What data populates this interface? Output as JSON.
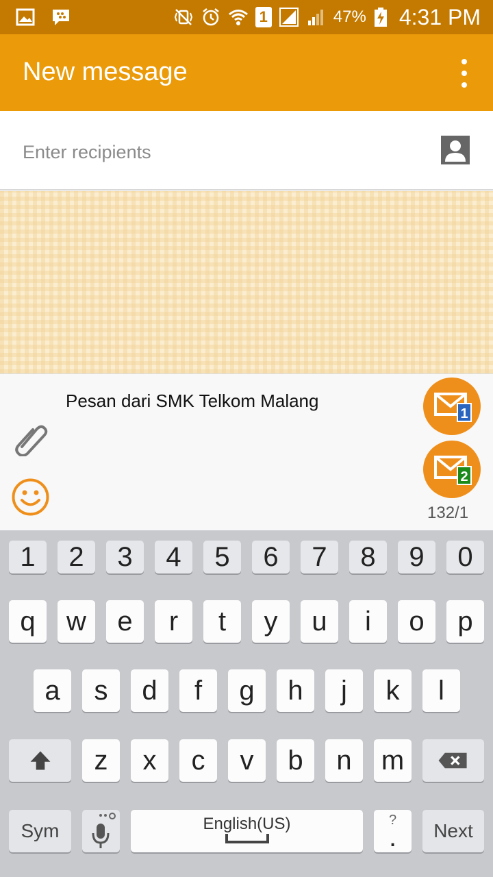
{
  "status_bar": {
    "battery": "47%",
    "time": "4:31 PM",
    "sim_slot": "1",
    "icons": [
      "gallery-icon",
      "bbm-icon",
      "vibrate-icon",
      "alarm-icon",
      "wifi-icon",
      "sim-icon",
      "signal-icon",
      "signal2-icon",
      "battery-charging-icon"
    ]
  },
  "appbar": {
    "title": "New message",
    "menu_icon": "overflow-menu-icon"
  },
  "recipients": {
    "placeholder": "Enter recipients",
    "value": "",
    "contact_icon": "contact-icon"
  },
  "composer": {
    "message": "Pesan dari SMK Telkom Malang",
    "counter": "132/1",
    "send_sim1_label": "1",
    "send_sim2_label": "2",
    "icons": [
      "attach-icon",
      "emoji-icon",
      "send-sim1-icon",
      "send-sim2-icon"
    ]
  },
  "keyboard": {
    "numbers": [
      "1",
      "2",
      "3",
      "4",
      "5",
      "6",
      "7",
      "8",
      "9",
      "0"
    ],
    "row1": [
      "q",
      "w",
      "e",
      "r",
      "t",
      "y",
      "u",
      "i",
      "o",
      "p"
    ],
    "row2": [
      "a",
      "s",
      "d",
      "f",
      "g",
      "h",
      "j",
      "k",
      "l"
    ],
    "row3": [
      "z",
      "x",
      "c",
      "v",
      "b",
      "n",
      "m"
    ],
    "sym": "Sym",
    "space_label": "English(US)",
    "period": ".",
    "period_hint": "?",
    "next": "Next"
  },
  "colors": {
    "status_bar": "#c47a00",
    "app_bar": "#eb9b09",
    "accent": "#ef8f1b",
    "sim1_badge": "#2a66c0",
    "sim2_badge": "#1a8a1a"
  }
}
